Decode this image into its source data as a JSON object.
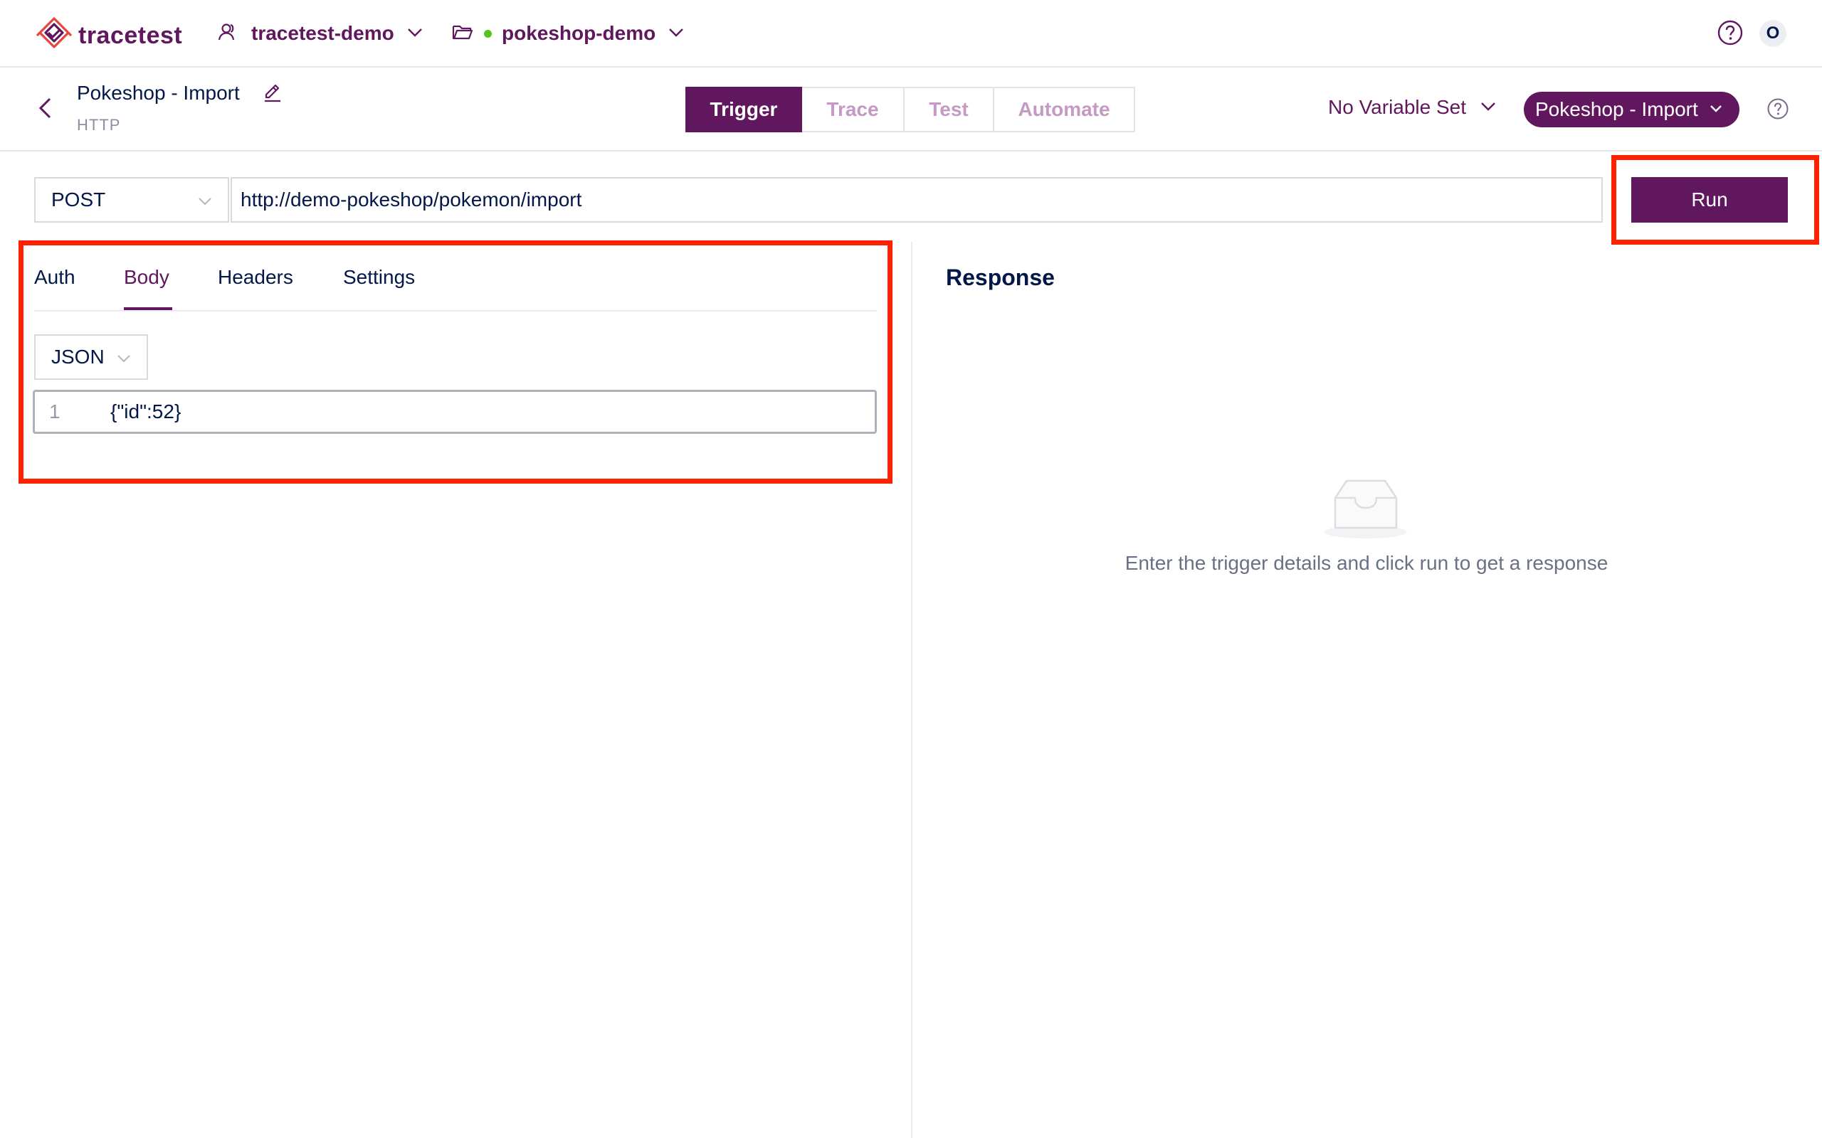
{
  "brand": {
    "name": "tracetest",
    "logo_icon": "tracetest-logo-icon",
    "color": "#61175e"
  },
  "topbar": {
    "organization": "tracetest-demo",
    "environment": "pokeshop-demo",
    "environment_status_color": "#52c41a",
    "avatar_initial": "O"
  },
  "test": {
    "name": "Pokeshop - Import",
    "type": "HTTP"
  },
  "mode_tabs": [
    {
      "label": "Trigger",
      "active": true
    },
    {
      "label": "Trace",
      "active": false
    },
    {
      "label": "Test",
      "active": false
    },
    {
      "label": "Automate",
      "active": false
    }
  ],
  "variable_set": "No Variable Set",
  "test_selector": "Pokeshop - Import",
  "request": {
    "method": "POST",
    "url": "http://demo-pokeshop/pokemon/import",
    "run_label": "Run"
  },
  "request_tabs": [
    {
      "label": "Auth"
    },
    {
      "label": "Body",
      "active": true
    },
    {
      "label": "Headers"
    },
    {
      "label": "Settings"
    }
  ],
  "body": {
    "content_type": "JSON",
    "lines": [
      {
        "num": "1",
        "code": "{\"id\":52}"
      }
    ]
  },
  "response": {
    "title": "Response",
    "empty_message": "Enter the trigger details and click run to get a response"
  },
  "highlight_color": "#ff2200"
}
